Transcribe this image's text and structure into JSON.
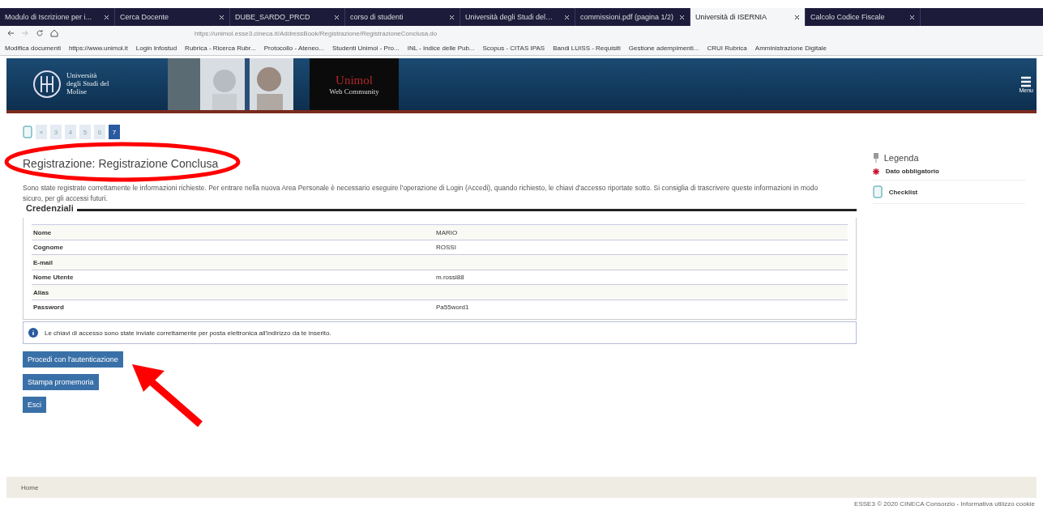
{
  "browser": {
    "tabs": [
      {
        "title": "Modulo di Iscrizione per i...",
        "selected": false
      },
      {
        "title": "Cerca Docente",
        "selected": false
      },
      {
        "title": "DUBE_SARDO_PRCD",
        "selected": false
      },
      {
        "title": "corso di studenti",
        "selected": false
      },
      {
        "title": "Università degli Studi del…",
        "selected": false
      },
      {
        "title": "commissioni.pdf (pagina 1/2)",
        "selected": false
      },
      {
        "title": "Università di ISERNIA",
        "selected": true
      },
      {
        "title": "Calcolo Codice Fiscale",
        "selected": false
      }
    ],
    "url": "https://unimol.esse3.cineca.it/AddressBook/Registrazione/RegistrazioneConclusa.do",
    "bookmarks": [
      "Modifica documenti",
      "https://www.unimol.it",
      "Login Infostud",
      "Rubrica - Ricerca Rubr...",
      "Protocollo - Ateneo...",
      "Studenti Unimol - Pro...",
      "INL - Indice delle Pub...",
      "Scopus - CITAS IPAS",
      "Bandi LUISS - Requisiti",
      "Gestione adempimenti...",
      "CRUI Rubrica",
      "Amministrazione Digitale"
    ]
  },
  "header": {
    "logo_text": "Università degli Studi del Molise",
    "community_title": "Unimol",
    "community_subtitle": "Web Community",
    "menu_label": "Menu"
  },
  "steps": [
    {
      "label": "«",
      "selected": false
    },
    {
      "label": "3",
      "selected": false
    },
    {
      "label": "4",
      "selected": false
    },
    {
      "label": "5",
      "selected": false
    },
    {
      "label": "6",
      "selected": false
    },
    {
      "label": "7",
      "selected": true
    }
  ],
  "page_title": "Registrazione: Registrazione Conclusa",
  "intro": "Sono state registrate correttamente le informazioni richieste. Per entrare nella nuova Area Personale è necessario eseguire l'operazione di Login (Accedi), quando richiesto, le chiavi d'accesso riportate sotto. Si consiglia di trascrivere queste informazioni in modo sicuro, per gli accessi futuri.",
  "credentials": {
    "legend": "Credenziali",
    "rows": [
      {
        "label": "Nome",
        "value": "MARIO"
      },
      {
        "label": "Cognome",
        "value": "ROSSI"
      },
      {
        "label": "E-mail"
      },
      {
        "label": "Nome Utente",
        "value": "m.rossi88"
      },
      {
        "label": "Alias"
      },
      {
        "label": "Password",
        "value": "Pa55word1"
      }
    ],
    "info": "Le chiavi di accesso sono state inviate correttamente per posta elettronica all'indirizzo da te inserito."
  },
  "buttons": [
    "Procedi con l'autenticazione",
    "Stampa promemoria",
    "Esci"
  ],
  "legenda": {
    "title": "Legenda",
    "items": [
      {
        "kind": "required",
        "label": "Dato obbligatorio"
      },
      {
        "kind": "checklist",
        "label": "Checklist"
      }
    ]
  },
  "footer": {
    "link": "Home",
    "copyright": "ESSE3 © 2020 CINECA Consorzio - Informativa utilizzo cookie"
  }
}
